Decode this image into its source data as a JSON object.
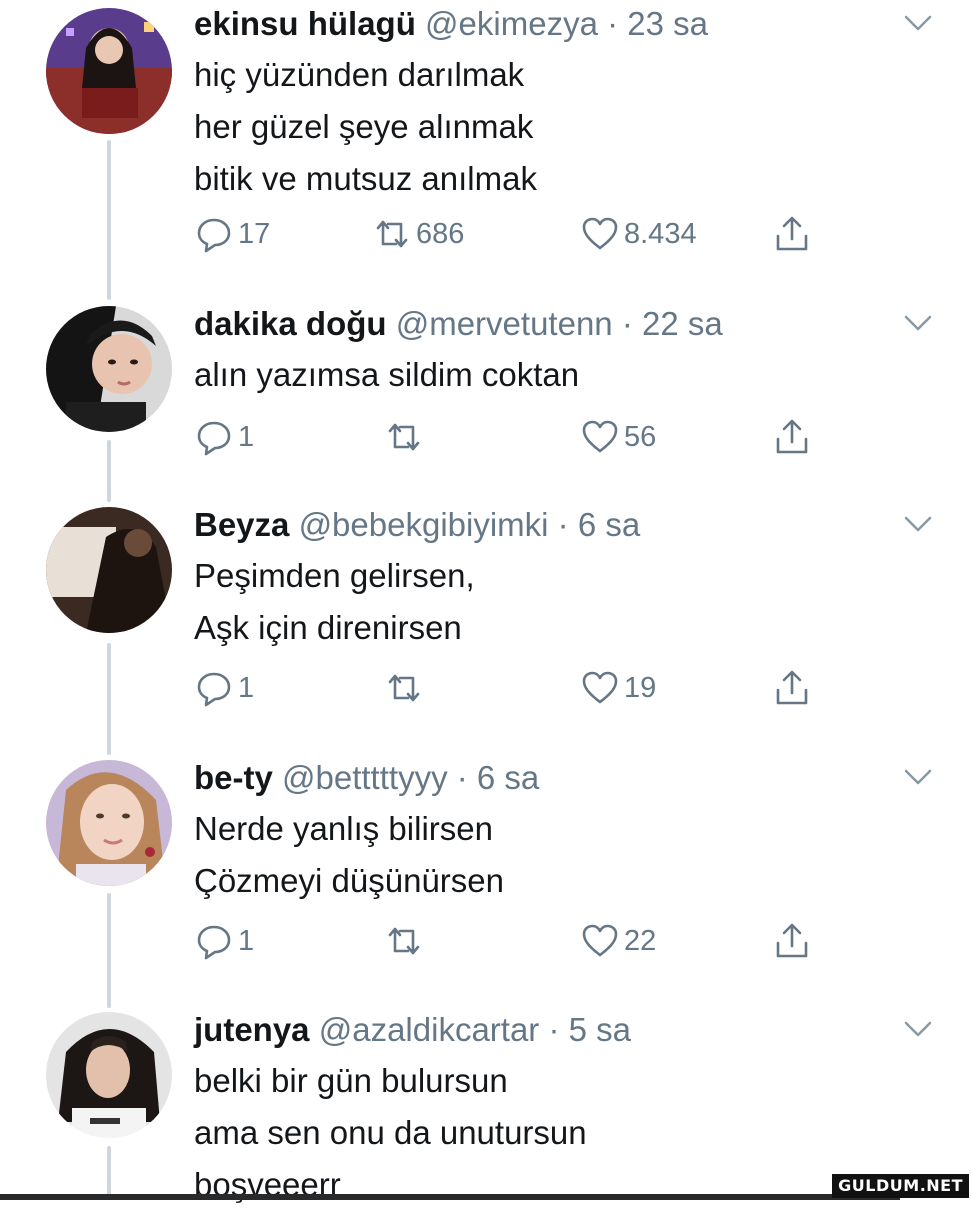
{
  "tweets": [
    {
      "name": "ekinsu hülagü",
      "handle": "@ekimezya",
      "time": "23 sa",
      "lines": [
        "hiç yüzünden darılmak",
        "her güzel şeye alınmak",
        "bitik ve mutsuz anılmak"
      ],
      "replies": "17",
      "retweets": "686",
      "likes": "8.434"
    },
    {
      "name": "dakika doğu",
      "handle": "@mervetutenn",
      "time": "22 sa",
      "lines": [
        "alın yazımsa sildim coktan"
      ],
      "replies": "1",
      "retweets": "",
      "likes": "56"
    },
    {
      "name": "Beyza",
      "handle": "@bebekgibiyimki",
      "time": "6 sa",
      "lines": [
        "Peşimden gelirsen,",
        "Aşk için direnirsen"
      ],
      "replies": "1",
      "retweets": "",
      "likes": "19"
    },
    {
      "name": "be-ty",
      "handle": "@betttttyyy",
      "time": "6 sa",
      "lines": [
        "Nerde yanlış bilirsen",
        "Çözmeyi düşünürsen"
      ],
      "replies": "1",
      "retweets": "",
      "likes": "22"
    },
    {
      "name": "jutenya",
      "handle": "@azaldikcartar",
      "time": "5 sa",
      "lines": [
        "belki bir gün bulursun",
        "ama sen onu da unutursun",
        "boşveeerr"
      ],
      "replies": "",
      "retweets": "",
      "likes": ""
    }
  ],
  "separator": " · ",
  "icons": {
    "reply": "reply-icon",
    "retweet": "retweet-icon",
    "like": "heart-icon",
    "share": "share-icon",
    "menu": "chevron-down-icon"
  },
  "colors": {
    "text": "#14171a",
    "secondary": "#657786",
    "thread_line": "#cfd6dc",
    "background": "#ffffff"
  },
  "watermark": "GULDUM.NET"
}
